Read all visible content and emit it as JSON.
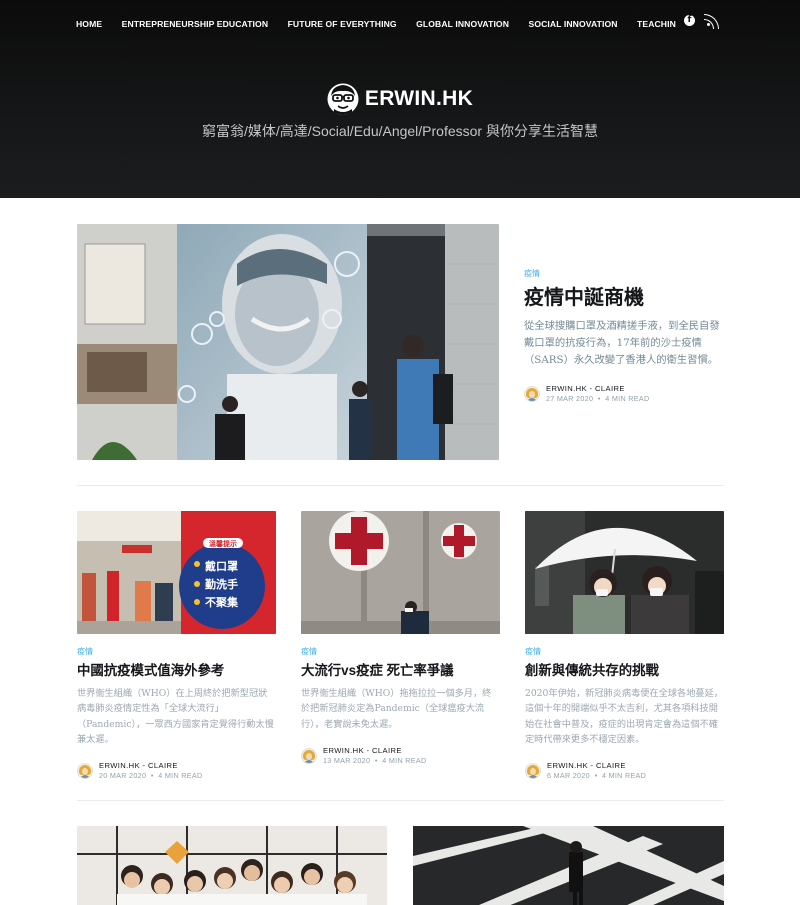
{
  "nav": {
    "items": [
      "HOME",
      "ENTREPRENEURSHIP EDUCATION",
      "FUTURE OF EVERYTHING",
      "GLOBAL INNOVATION",
      "SOCIAL INNOVATION",
      "TEACHING SKILLS & E"
    ],
    "icons": [
      "facebook-icon",
      "rss-icon"
    ]
  },
  "brand": {
    "name": "ERWIN.HK",
    "tagline": "窮富翁/媒体/高達/Social/Edu/Angel/Professor 與你分享生活智慧"
  },
  "hero": {
    "tag": "疫情",
    "title": "疫情中誕商機",
    "excerpt": "從全球搜購口罩及酒精搓手液，到全民自發戴口罩的抗疫行為，17年前的沙士疫情（SARS）永久改變了香港人的衛生習慣。",
    "author": "ERWIN.HK - CLAIRE",
    "date": "27 MAR 2020",
    "read_time": "4 MIN READ"
  },
  "cards": [
    {
      "tag": "疫情",
      "title": "中國抗疫模式值海外參考",
      "excerpt": "世界衞生組織（WHO）在上周終於把新型冠狀病毒肺炎疫情定性為「全球大流行」（Pandemic），一眾西方國家肯定覺得行動太慢兼太遲。",
      "author": "ERWIN.HK - CLAIRE",
      "date": "20 MAR 2020",
      "read_time": "4 MIN READ",
      "sign_lines": [
        "溫馨提示",
        "戴口罩",
        "勤洗手",
        "不聚集"
      ]
    },
    {
      "tag": "疫情",
      "title": "大流行vs疫症 死亡率爭議",
      "excerpt": "世界衞生組織（WHO）拖拖拉拉一個多月，終於把新冠肺炎定為Pandemic（全球瘟疫大流行），老實說未免太遲。",
      "author": "ERWIN.HK - CLAIRE",
      "date": "13 MAR 2020",
      "read_time": "4 MIN READ"
    },
    {
      "tag": "疫情",
      "title": "創新與傳統共存的挑戰",
      "excerpt": "2020年伊始，新冠肺炎病毒便在全球各地蔓延，這個十年的開端似乎不太吉利，尤其各項科技開始在社會中普及，疫症的出現肯定會為這個不確定時代帶來更多不穩定因素。",
      "author": "ERWIN.HK - CLAIRE",
      "date": "6 MAR 2020",
      "read_time": "4 MIN READ"
    }
  ],
  "date_separator": "•",
  "colors": {
    "accent": "#3eb0ef",
    "header_bg": "#151617",
    "excerpt": "#738a94"
  }
}
